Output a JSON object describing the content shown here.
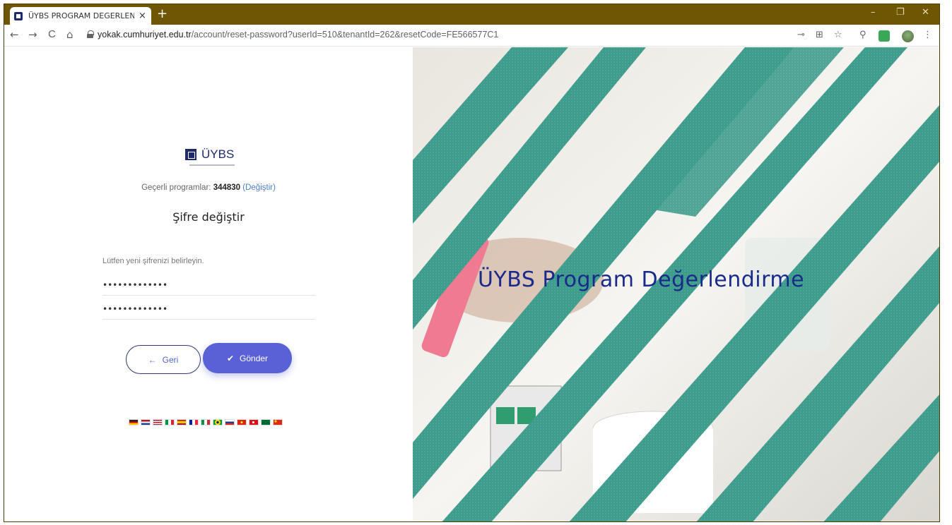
{
  "browser": {
    "tab_title": "ÜYBS PROGRAM DEGERLENDİRM",
    "tab_close": "×",
    "new_tab": "+",
    "url_host": "yokak.cumhuriyet.edu.tr",
    "url_path": "/account/reset-password?userId=510&tenantId=262&resetCode=FE566577C1",
    "window_controls": {
      "minimize": "–",
      "restore": "❐",
      "close": "✕"
    },
    "nav": {
      "back": "←",
      "forward": "→",
      "reload": "C",
      "home": "⌂"
    }
  },
  "logo": {
    "text": "ÜYBS"
  },
  "current_program": {
    "label": "Geçerli programlar:",
    "code": "344830",
    "change_link": "Değiştir"
  },
  "form": {
    "title": "Şifre değiştir",
    "hint": "Lütfen yeni şifrenizi belirleyin.",
    "password_value": "•••••••••••••",
    "password_confirm_value": "•••••••••••••",
    "back_label": "Geri",
    "submit_label": "Gönder"
  },
  "languages": [
    "de",
    "nl",
    "en",
    "it",
    "es",
    "fr",
    "it2",
    "pt-br",
    "ru",
    "vi",
    "tr",
    "ar",
    "zh"
  ],
  "banner": {
    "text": "ÜYBS Program Değerlendirme"
  },
  "colors": {
    "titlebar": "#6e5604",
    "accent": "#5a61d6",
    "brand": "#1f2a6b",
    "teal": "#3f9b8b"
  }
}
